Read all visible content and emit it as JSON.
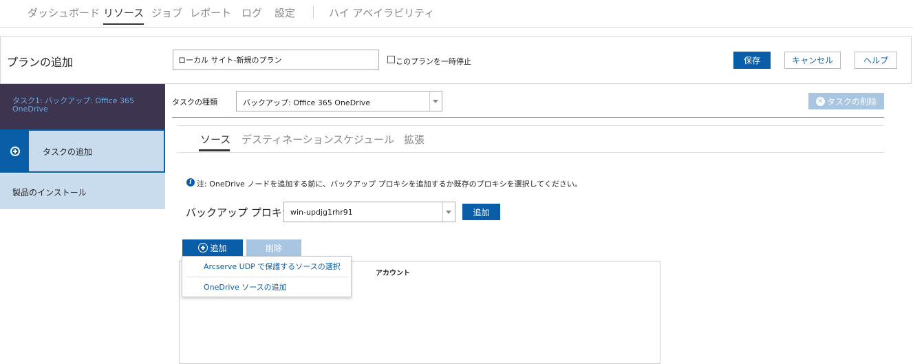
{
  "nav": {
    "items": [
      "ダッシュボード",
      "リソース",
      "ジョブ",
      "レポート",
      "ログ",
      "設定",
      "ハイ アベイラビリティ"
    ],
    "active": "リソース"
  },
  "header": {
    "title": "プランの追加",
    "plan_name": "ローカル サイト-新規のプラン",
    "pause_label": "このプランを一時停止",
    "save_label": "保存",
    "cancel_label": "キャンセル",
    "help_label": "ヘルプ"
  },
  "sidebar": {
    "task1_label": "タスク1: バックアップ: Office 365 OneDrive",
    "add_task_label": "タスクの追加",
    "install_label": "製品のインストール"
  },
  "task": {
    "type_label": "タスクの種類",
    "type_value": "バックアップ: Office 365 OneDrive",
    "delete_label": "タスクの削除"
  },
  "tabs": [
    "ソース",
    "デスティネーション",
    "スケジュール",
    "拡張"
  ],
  "source": {
    "note": "注: OneDrive ノードを追加する前に、バックアップ プロキシを追加するか既存のプロキシを選択してください。",
    "proxy_label": "バックアップ プロキシ",
    "proxy_value": "win-updjg1rhr91",
    "proxy_add_label": "追加",
    "add_label": "追加",
    "delete_label": "削除",
    "column_account": "アカウント",
    "menu": [
      "Arcserve UDP で保護するソースの選択",
      "OneDrive ソースの追加"
    ]
  },
  "colors": {
    "primary": "#0a5ea8",
    "disabled": "#a8c6e2",
    "sidebar_dark": "#3d3550",
    "sidebar_light": "#c9dcee"
  }
}
